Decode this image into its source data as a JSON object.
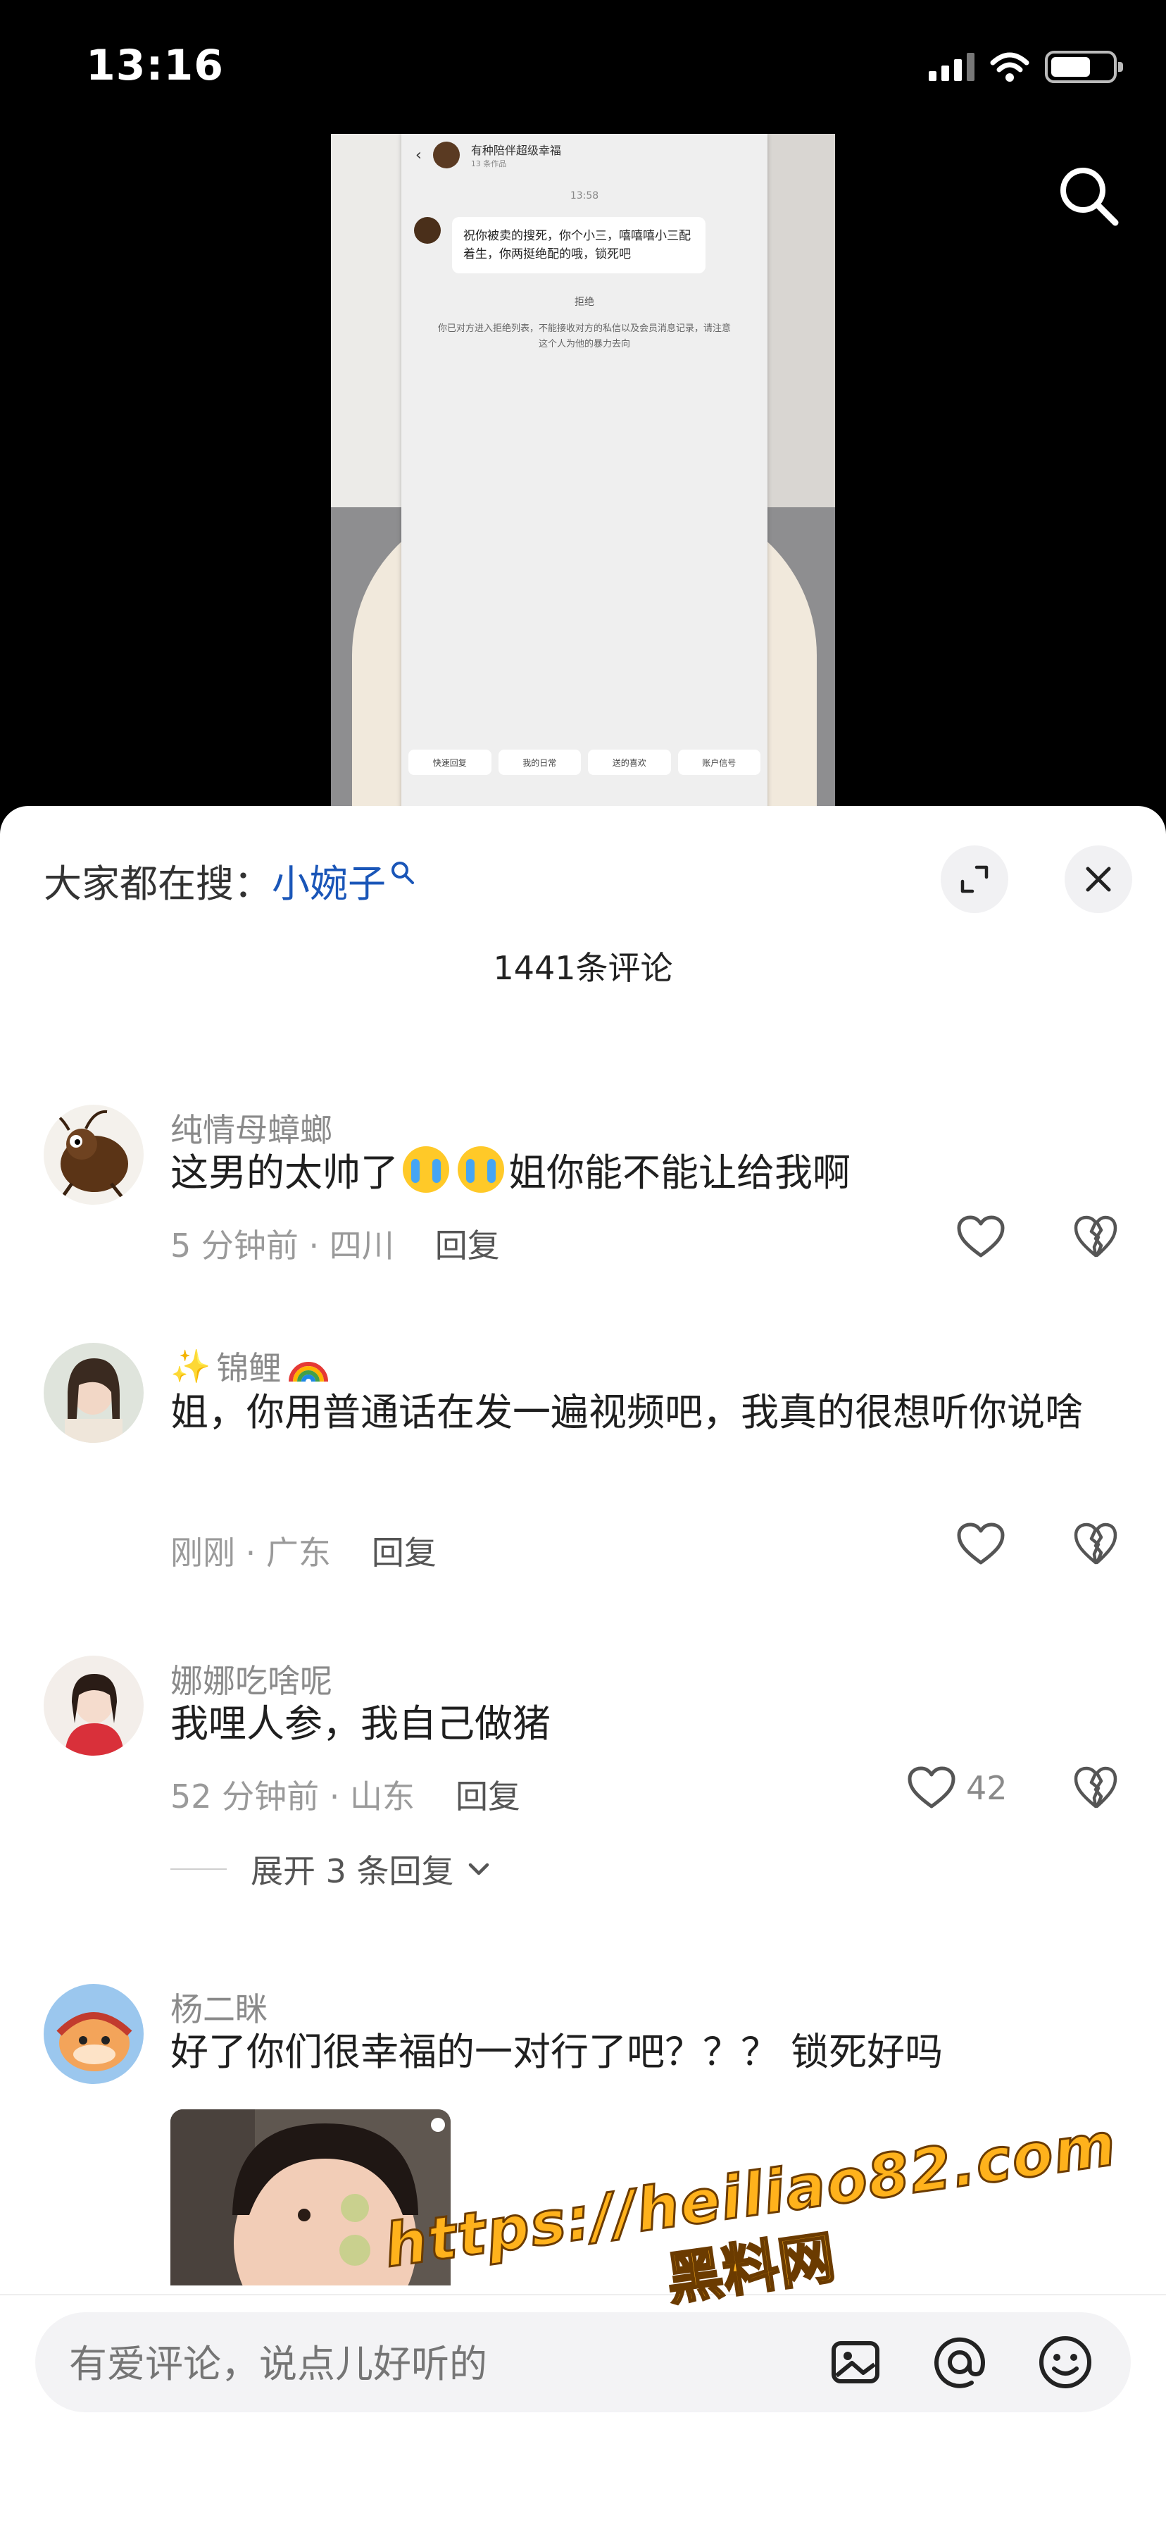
{
  "status_bar": {
    "time": "13:16"
  },
  "video": {
    "chat_header_title": "有种陪伴超级幸福",
    "chat_header_sub": "13 条作品",
    "chat_time": "13:58",
    "chat_message": "祝你被卖的搜死，你个小三，嘻嘻嘻小三配着生，你两挺绝配的哦，锁死吧",
    "chat_label": "拒绝",
    "chat_note": "你已对方进入拒绝列表，不能接收对方的私信以及会员消息记录，请注意这个人为他的暴力去向",
    "quick_replies": [
      "快速回复",
      "我的日常",
      "送的喜欢",
      "账户信号"
    ]
  },
  "panel": {
    "trending_prefix": "大家都在搜：",
    "trending_keyword": "小婉子",
    "comment_count": "1441条评论"
  },
  "comments": [
    {
      "user": "纯情母蟑螂",
      "text_before": "这男的太帅了",
      "text_after": "姐你能不能让给我啊",
      "meta": "5 分钟前 · 四川",
      "reply_label": "回复",
      "likes": ""
    },
    {
      "user": "锦鲤",
      "user_prefix_emoji": "✨",
      "user_suffix_emoji": "rainbow",
      "text": "姐，你用普通话在发一遍视频吧，我真的很想听你说啥",
      "meta": "刚刚 · 广东",
      "reply_label": "回复",
      "likes": ""
    },
    {
      "user": "娜娜吃啥呢",
      "text": "我哩人参，我自己做猪",
      "meta": "52 分钟前 · 山东",
      "reply_label": "回复",
      "likes": "42",
      "expand_replies": "展开 3 条回复"
    },
    {
      "user": "杨二眯",
      "text": "好了你们很幸福的一对行了吧？？？ 锁死好吗",
      "meta": "",
      "reply_label": "",
      "likes": ""
    }
  ],
  "input_bar": {
    "placeholder": "有爱评论，说点儿好听的"
  },
  "watermark": {
    "line1": "https://heiliao82.com",
    "line2": "黑料网"
  },
  "colors": {
    "accent_link": "#1a56b8",
    "watermark": "#ffb21c",
    "panel_bg": "#ffffff"
  },
  "icons": [
    "search-icon",
    "expand-icon",
    "close-icon",
    "heart-icon",
    "broken-heart-icon",
    "image-icon",
    "at-icon",
    "emoji-icon",
    "chevron-down-icon"
  ]
}
